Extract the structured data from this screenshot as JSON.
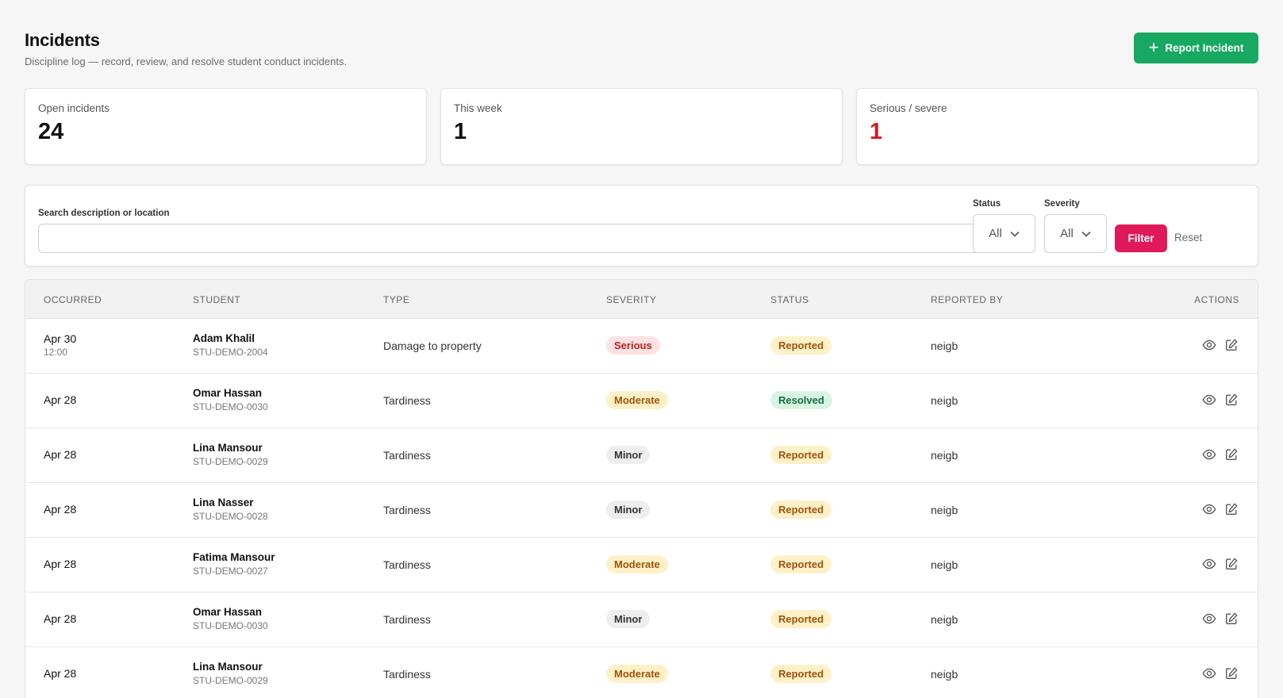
{
  "header": {
    "title": "Incidents",
    "subtitle": "Discipline log — record, review, and resolve student conduct incidents.",
    "report_button": "Report Incident"
  },
  "stats": [
    {
      "label": "Open incidents",
      "value": "24"
    },
    {
      "label": "This week",
      "value": "1"
    },
    {
      "label": "Serious / severe",
      "value": "1"
    }
  ],
  "filters": {
    "search_label": "Search description or location",
    "search_value": "",
    "status_label": "Status",
    "status_value": "All",
    "severity_label": "Severity",
    "severity_value": "All",
    "filter_button": "Filter",
    "reset_button": "Reset"
  },
  "table": {
    "columns": [
      "OCCURRED",
      "STUDENT",
      "TYPE",
      "SEVERITY",
      "STATUS",
      "REPORTED BY",
      "ACTIONS"
    ],
    "rows": [
      {
        "date": "Apr 30",
        "time": "12:00",
        "student": "Adam Khalil",
        "student_id": "STU-DEMO-2004",
        "type": "Damage to property",
        "severity": "Serious",
        "status": "Reported",
        "reported_by": "neigb"
      },
      {
        "date": "Apr 28",
        "time": "",
        "student": "Omar Hassan",
        "student_id": "STU-DEMO-0030",
        "type": "Tardiness",
        "severity": "Moderate",
        "status": "Resolved",
        "reported_by": "neigb"
      },
      {
        "date": "Apr 28",
        "time": "",
        "student": "Lina Mansour",
        "student_id": "STU-DEMO-0029",
        "type": "Tardiness",
        "severity": "Minor",
        "status": "Reported",
        "reported_by": "neigb"
      },
      {
        "date": "Apr 28",
        "time": "",
        "student": "Lina Nasser",
        "student_id": "STU-DEMO-0028",
        "type": "Tardiness",
        "severity": "Minor",
        "status": "Reported",
        "reported_by": "neigb"
      },
      {
        "date": "Apr 28",
        "time": "",
        "student": "Fatima Mansour",
        "student_id": "STU-DEMO-0027",
        "type": "Tardiness",
        "severity": "Moderate",
        "status": "Reported",
        "reported_by": "neigb"
      },
      {
        "date": "Apr 28",
        "time": "",
        "student": "Omar Hassan",
        "student_id": "STU-DEMO-0030",
        "type": "Tardiness",
        "severity": "Minor",
        "status": "Reported",
        "reported_by": "neigb"
      },
      {
        "date": "Apr 28",
        "time": "",
        "student": "Lina Mansour",
        "student_id": "STU-DEMO-0029",
        "type": "Tardiness",
        "severity": "Moderate",
        "status": "Reported",
        "reported_by": "neigb"
      }
    ]
  },
  "icons": {
    "view": "eye-icon",
    "edit": "edit-icon",
    "add": "plus-icon",
    "dropdown": "chevron-down-icon"
  },
  "colors": {
    "primary": "#17a861",
    "filter": "#e0195b",
    "danger": "#d61a1a"
  }
}
